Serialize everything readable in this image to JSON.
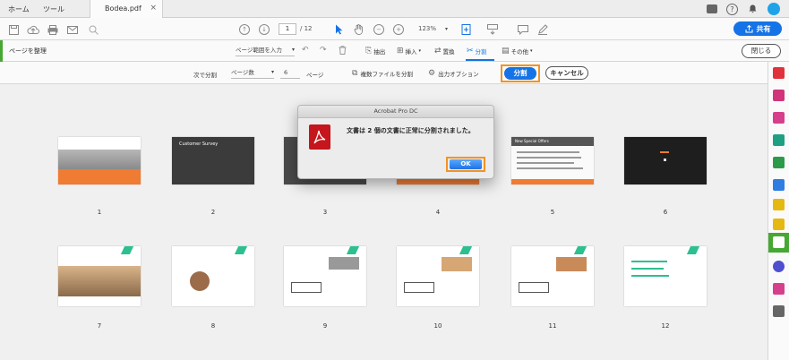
{
  "tabbar": {
    "home": "ホーム",
    "tools": "ツール",
    "document_tab": "Bodea.pdf",
    "close_tab": "×"
  },
  "toolbar": {
    "page_current": "1",
    "page_total": "/ 12",
    "zoom": "123%",
    "share_label": "共有"
  },
  "organize": {
    "title": "ページを整理",
    "range_select": "ページ範囲を入力",
    "extract": "抽出",
    "insert": "挿入",
    "replace": "置換",
    "split": "分割",
    "more": "その他",
    "close": "閉じる"
  },
  "split_options": {
    "split_by_label": "次で分割",
    "split_by_value": "ページ数",
    "page_count": "6",
    "page_unit": "ページ",
    "split_multiple": "複数ファイルを分割",
    "output_options": "出力オプション",
    "split_button": "分割",
    "cancel_button": "キャンセル"
  },
  "dialog": {
    "title": "Acrobat Pro DC",
    "message": "文書は 2 個の文書に正常に分割されました。",
    "ok": "OK"
  },
  "thumbnails": [
    {
      "num": "1"
    },
    {
      "num": "2"
    },
    {
      "num": "3"
    },
    {
      "num": "4"
    },
    {
      "num": "5"
    },
    {
      "num": "6"
    },
    {
      "num": "7"
    },
    {
      "num": "8"
    },
    {
      "num": "9"
    },
    {
      "num": "10"
    },
    {
      "num": "11"
    },
    {
      "num": "12"
    }
  ],
  "thumb_text": {
    "p2": "Customer Survey",
    "p5": "New Special Offers"
  },
  "colors": {
    "accent_blue": "#1473e6",
    "highlight_orange": "#f29423",
    "organize_green": "#46a832",
    "acrobat_red": "#c4161c"
  }
}
